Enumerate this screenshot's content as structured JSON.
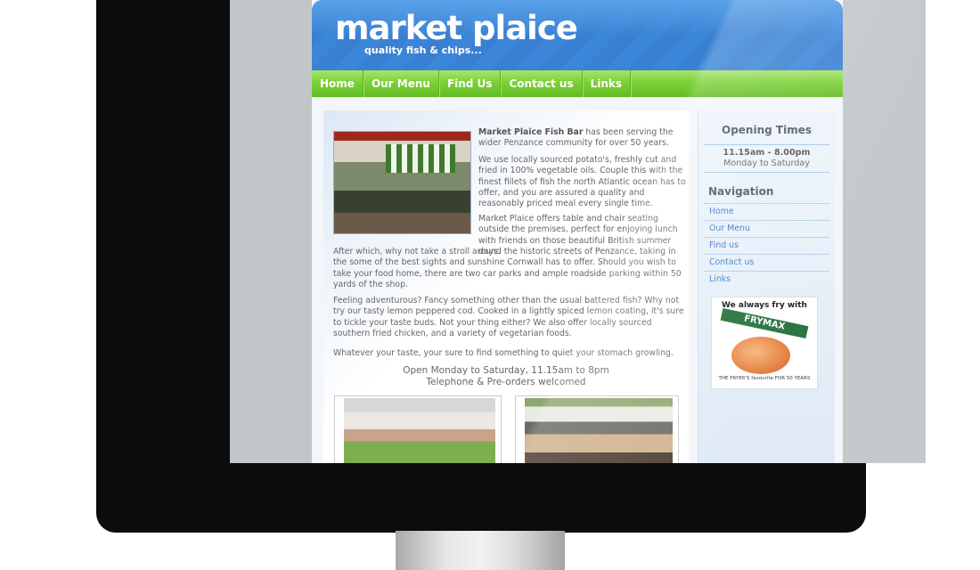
{
  "site": {
    "logo": "market plaice",
    "tagline": "quality fish & chips..."
  },
  "nav": [
    "Home",
    "Our Menu",
    "Find Us",
    "Contact us",
    "Links"
  ],
  "content": {
    "intro_strong": "Market Plaice Fish Bar",
    "intro_rest": " has been serving the wider Penzance community for over 50 years.",
    "p2": "We use locally sourced potato's, freshly cut and fried in 100% vegetable oils. Couple this with the finest fillets of fish the north Atlantic ocean has to offer, and you are assured a quality and reasonably priced meal every single time.",
    "p3": "Market Plaice offers table and chair seating outside the premises, perfect for enjoying lunch with friends on those beautiful British summer days.",
    "p3b": "After which, why not take a stroll around the historic streets of Penzance, taking in the some of the best sights and sunshine Cornwall has to offer. Should you wish to take your food home, there are two car parks and ample roadside parking within 50 yards of the shop.",
    "p4": "Feeling adventurous? Fancy something other than the usual battered fish? Why not try our tasty lemon peppered cod. Cooked in a lightly spiced lemon coating, it's sure to tickle your taste buds. Not your thing either? We also offer locally sourced southern fried chicken, and a variety of vegetarian foods.",
    "p5": "Whatever your taste, your sure to find something to quiet your stomach growling.",
    "open_line1": "Open Monday to Saturday, 11.15am to 8pm",
    "open_line2": "Telephone & Pre-orders welcomed",
    "shop_sign": "the Market Plaice fish bar"
  },
  "sidebar": {
    "opening_title": "Opening Times",
    "opening_time": "11.15am - 8.00pm",
    "opening_days": "Monday to Saturday",
    "navigation_title": "Navigation",
    "links": [
      "Home",
      "Our Menu",
      "Find us",
      "Contact us",
      "Links"
    ],
    "badge_top": "We always fry with",
    "badge_brand": "FRYMAX",
    "badge_sub": "ALL VEGETABLE FRYING FAT",
    "badge_bottom": "THE FRYER'S favourite FOR 50 YEARS"
  }
}
